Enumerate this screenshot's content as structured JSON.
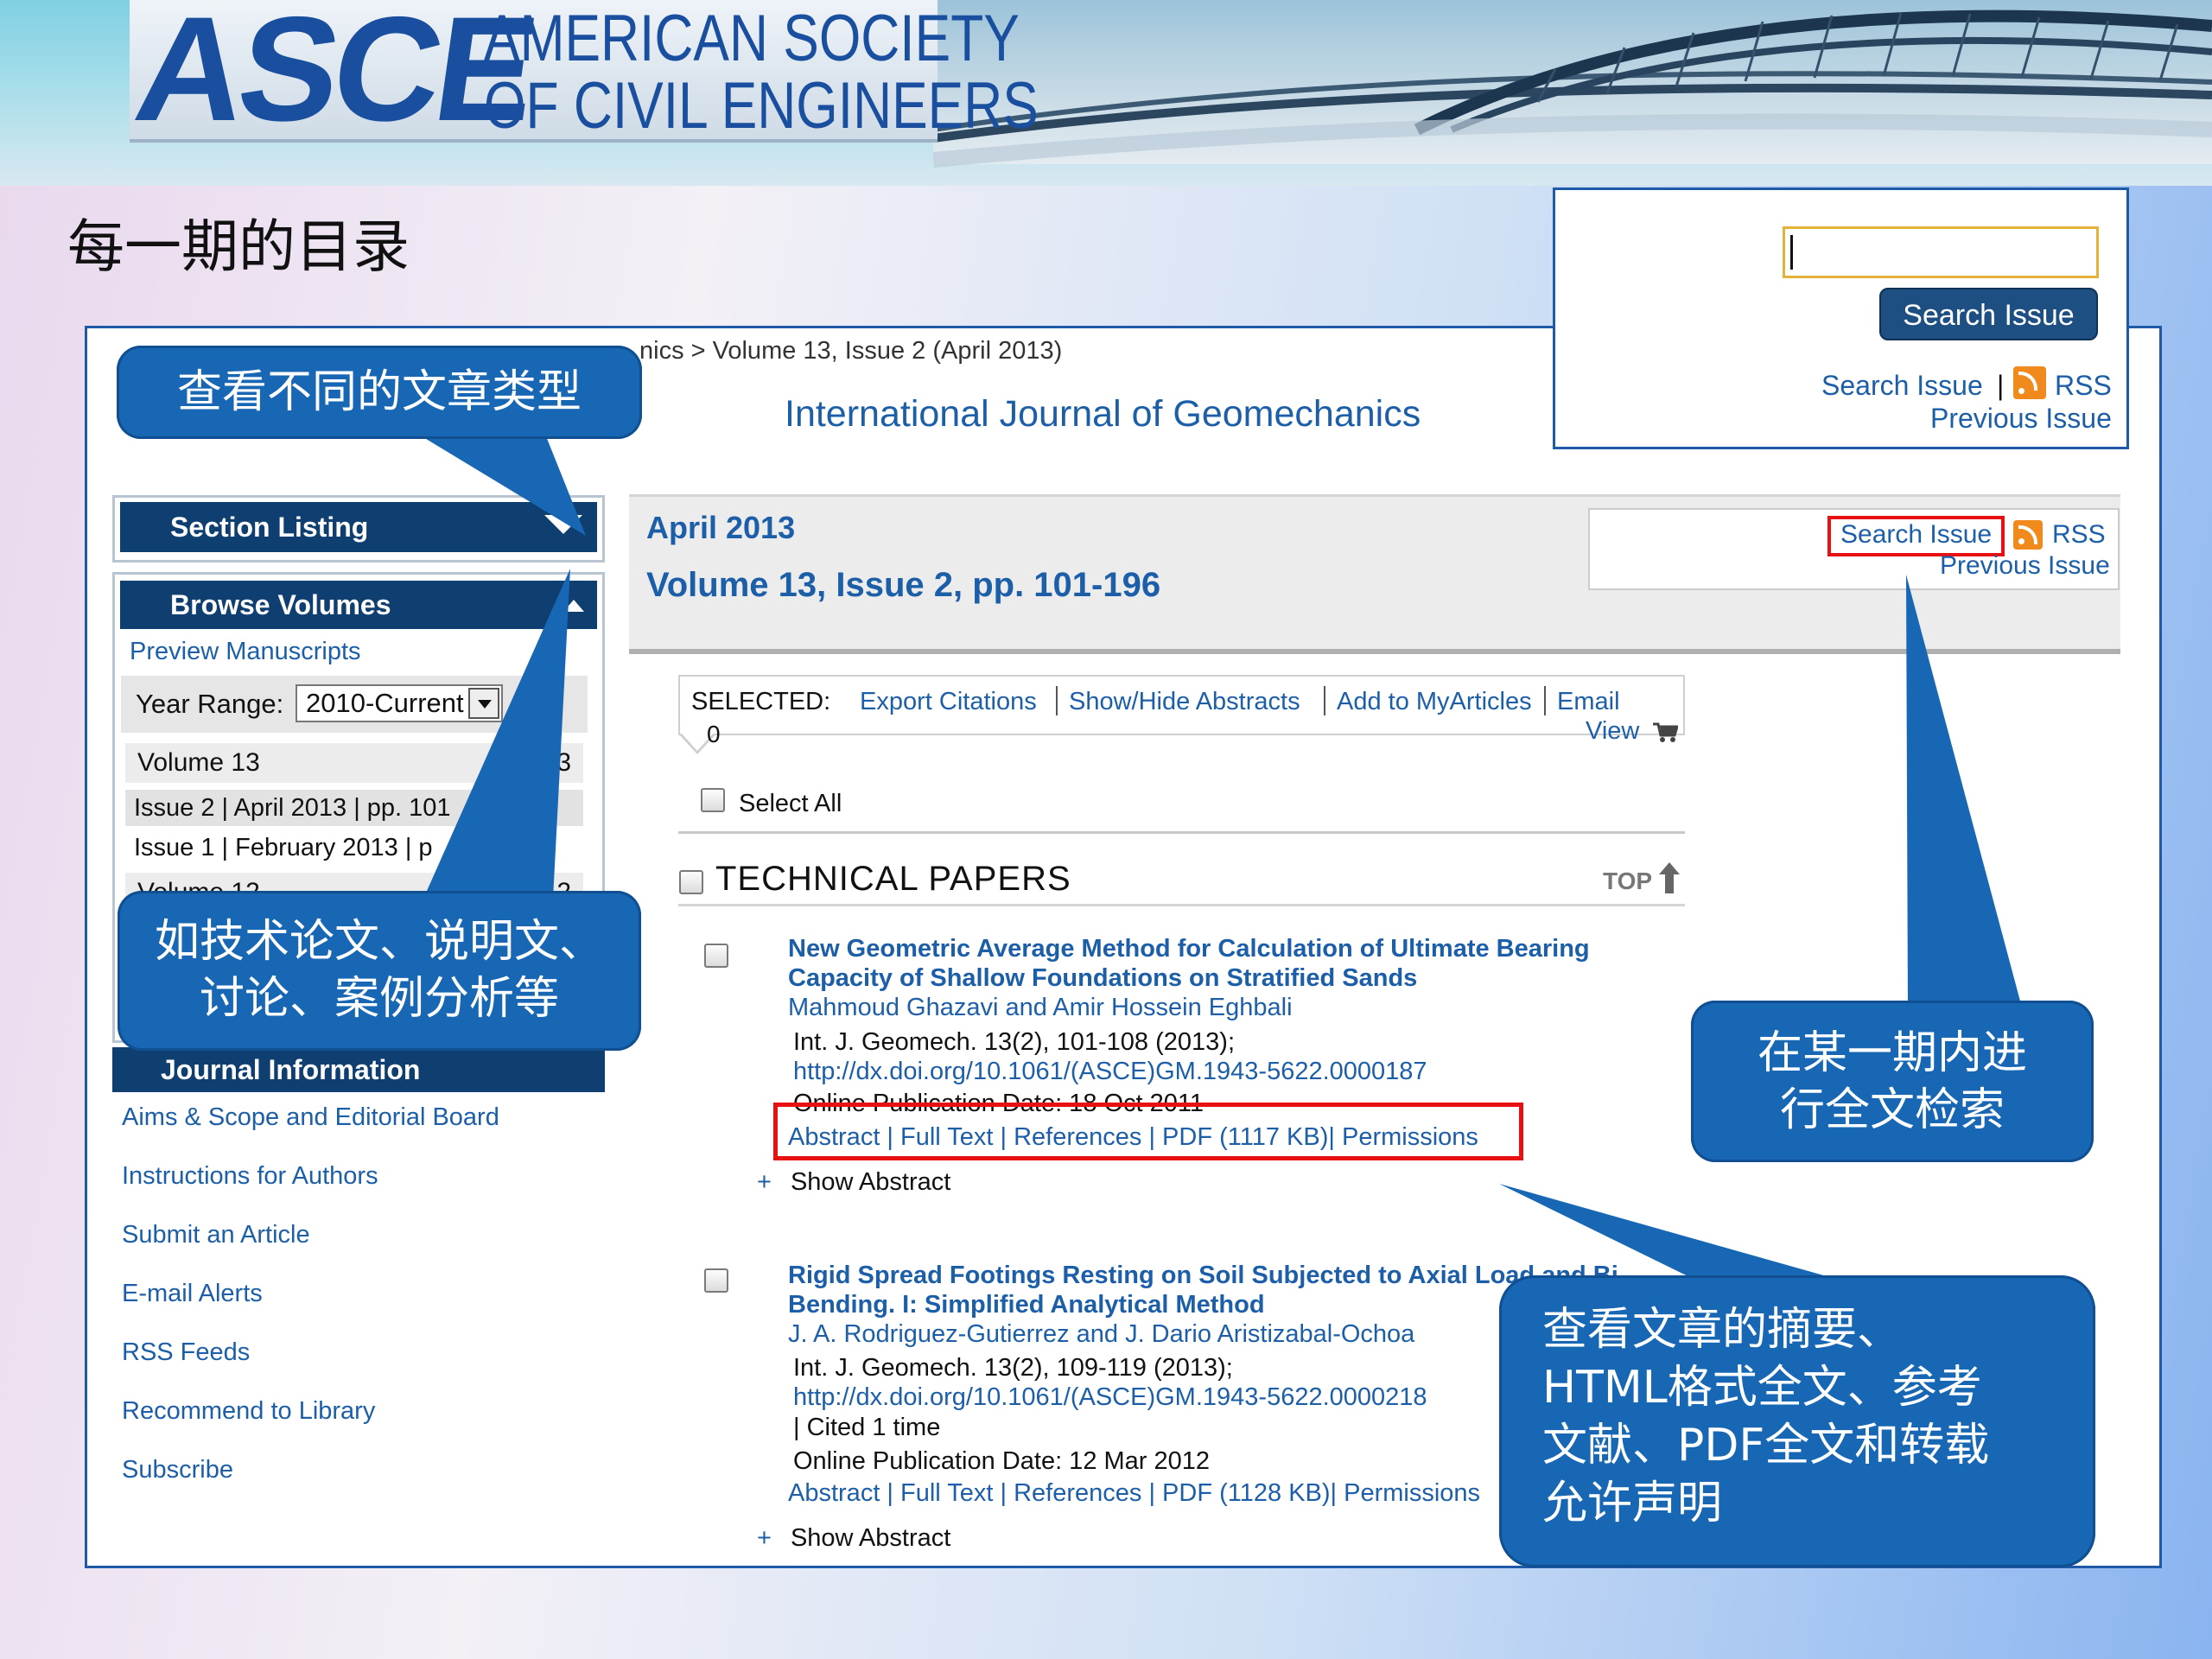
{
  "header": {
    "logo_mark": "ASCE",
    "logo_line1": "AMERICAN SOCIETY",
    "logo_line2": "OF CIVIL ENGINEERS",
    "slide_title": "每一期的目录"
  },
  "breadcrumb": "nics  >  Volume 13, Issue 2 (April 2013)",
  "journal_title": "International Journal of Geomechanics",
  "float_search": {
    "button": "Search Issue",
    "search_link": "Search Issue",
    "separator": "|",
    "rss": "RSS",
    "previous": "Previous Issue"
  },
  "sidebar": {
    "section_listing": "Section Listing",
    "browse_volumes": "Browse Volumes",
    "preview": "Preview Manuscripts",
    "year_range_label": "Year Range:",
    "year_range_value": "2010-Current",
    "volume13": "Volume 13",
    "volume13_num": "3",
    "issue2": "Issue 2 | April 2013 | pp. 101",
    "issue1": "Issue 1 | February 2013 | p",
    "volume12": "Volume 12",
    "volume12_num": "2",
    "journal_info": "Journal Information",
    "links": [
      "Aims & Scope and Editorial Board",
      "Instructions for Authors",
      "Submit an Article",
      "E-mail Alerts",
      "RSS Feeds",
      "Recommend to Library",
      "Subscribe"
    ]
  },
  "issue": {
    "month": "April 2013",
    "volume": "Volume 13, Issue 2, pp. 101-196",
    "search_issue": "Search Issue",
    "rss": "RSS",
    "previous": "Previous Issue"
  },
  "toolbar": {
    "selected_label": "SELECTED:",
    "count": "0",
    "export": "Export Citations",
    "showhide": "Show/Hide Abstracts",
    "myarticles": "Add to MyArticles",
    "email": "Email",
    "view": "View",
    "select_all": "Select All"
  },
  "section": {
    "title": "TECHNICAL PAPERS",
    "top": "TOP"
  },
  "articles": [
    {
      "title1": "New Geometric Average Method for Calculation of Ultimate Bearing",
      "title2": "Capacity of Shallow Foundations on Stratified Sands",
      "authors": "Mahmoud Ghazavi and Amir Hossein Eghbali",
      "ref": "Int. J. Geomech. 13(2), 101-108 (2013);",
      "doi": "http://dx.doi.org/10.1061/(ASCE)GM.1943-5622.0000187",
      "online": "Online Publication Date: 18 Oct 2011",
      "links": "Abstract | Full Text | References | PDF (1117 KB)| Permissions",
      "show_abstract": "Show Abstract"
    },
    {
      "title1": "Rigid Spread Footings Resting on Soil Subjected to Axial Load and Bi",
      "title2": "Bending. I: Simplified Analytical Method",
      "authors": "J. A. Rodriguez-Gutierrez and J. Dario Aristizabal-Ochoa",
      "ref": "Int. J. Geomech. 13(2), 109-119 (2013);",
      "doi": "http://dx.doi.org/10.1061/(ASCE)GM.1943-5622.0000218",
      "cited": "| Cited 1 time",
      "online": "Online Publication Date: 12 Mar 2012",
      "links": "Abstract | Full Text | References | PDF (1128 KB)| Permissions",
      "show_abstract": "Show Abstract"
    }
  ],
  "callouts": {
    "c1": "查看不同的文章类型",
    "c2_line1": "如技术论文、说明文、",
    "c2_line2": "讨论、案例分析等",
    "c3_line1": "在某一期内进",
    "c3_line2": "行全文检索",
    "c4_line1": "查看文章的摘要、",
    "c4_line2": "HTML格式全文、参考",
    "c4_line3": "文献、PDF全文和转载",
    "c4_line4": "允许声明"
  },
  "colors": {
    "brand_blue": "#1a4fa0",
    "link_blue": "#1c5fa8",
    "sidebar_navy": "#0f3e70",
    "callout_blue": "#1767b5",
    "highlight_red": "#e81010",
    "rss_orange": "#f08a1c"
  },
  "icons": [
    "rss-icon",
    "cart-icon",
    "top-arrow-icon",
    "dropdown-arrow-icon",
    "chevron-down-icon",
    "chevron-up-icon"
  ]
}
